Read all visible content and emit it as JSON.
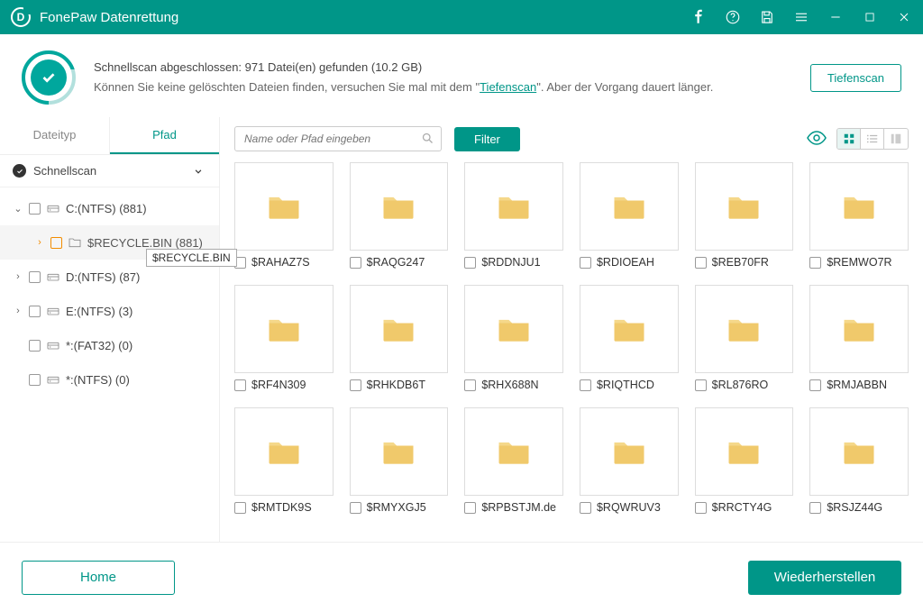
{
  "app_title": "FonePaw Datenrettung",
  "info": {
    "line1": "Schnellscan abgeschlossen: 971 Datei(en) gefunden (10.2 GB)",
    "line2_pre": "Können Sie keine gelöschten Dateien finden, versuchen Sie mal mit dem \"",
    "deeplink": "Tiefenscan",
    "line2_post": "\". Aber der Vorgang dauert länger."
  },
  "deepscan_btn": "Tiefenscan",
  "tabs": {
    "type": "Dateityp",
    "path": "Pfad"
  },
  "tree": {
    "head": "Schnellscan",
    "items": [
      {
        "label": "C:(NTFS) (881)",
        "expanded": true,
        "indent": 0
      },
      {
        "label": "$RECYCLE.BIN (881)",
        "highlight": true,
        "indent": 1,
        "folder": true
      },
      {
        "label": "D:(NTFS) (87)",
        "expanded": false,
        "indent": 0
      },
      {
        "label": "E:(NTFS) (3)",
        "expanded": false,
        "indent": 0
      },
      {
        "label": "*:(FAT32) (0)",
        "indent": 0,
        "noexp": true
      },
      {
        "label": "*:(NTFS) (0)",
        "indent": 0,
        "noexp": true
      }
    ],
    "tooltip": "$RECYCLE.BIN"
  },
  "search_placeholder": "Name oder Pfad eingeben",
  "filter_btn": "Filter",
  "files": [
    "$RAHAZ7S",
    "$RAQG247",
    "$RDDNJU1",
    "$RDIOEAH",
    "$REB70FR",
    "$REMWO7R",
    "$RF4N309",
    "$RHKDB6T",
    "$RHX688N",
    "$RIQTHCD",
    "$RL876RO",
    "$RMJABBN",
    "$RMTDK9S",
    "$RMYXGJ5",
    "$RPBSTJM.de",
    "$RQWRUV3",
    "$RRCTY4G",
    "$RSJZ44G"
  ],
  "footer": {
    "home": "Home",
    "recover": "Wiederherstellen"
  }
}
